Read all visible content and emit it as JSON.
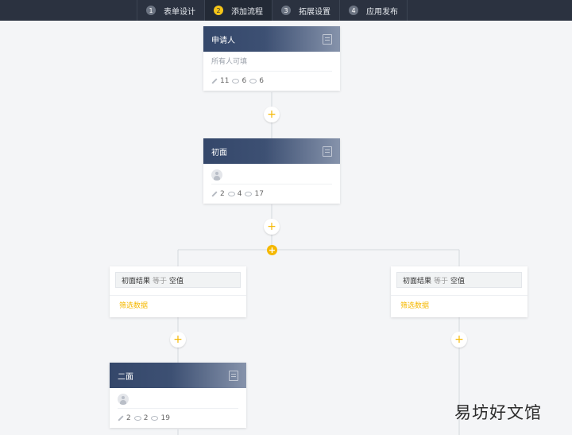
{
  "steps": [
    {
      "num": "1",
      "label": "表单设计"
    },
    {
      "num": "2",
      "label": "添加流程"
    },
    {
      "num": "3",
      "label": "拓展设置"
    },
    {
      "num": "4",
      "label": "应用发布"
    }
  ],
  "nodes": {
    "applicant": {
      "title": "申请人",
      "subtitle": "所有人可填",
      "edit": "11",
      "view1": "6",
      "view2": "6"
    },
    "first": {
      "title": "初面",
      "edit": "2",
      "view1": "4",
      "view2": "17"
    },
    "second": {
      "title": "二面",
      "edit": "2",
      "view1": "2",
      "view2": "19"
    }
  },
  "conditions": {
    "left": {
      "field": "初面结果",
      "operator": "等于",
      "value": "空值",
      "link": "筛选数据"
    },
    "right": {
      "field": "初面结果",
      "operator": "等于",
      "value": "空值",
      "link": "筛选数据"
    }
  },
  "plus_symbol": "+",
  "watermark": "易坊好文馆"
}
